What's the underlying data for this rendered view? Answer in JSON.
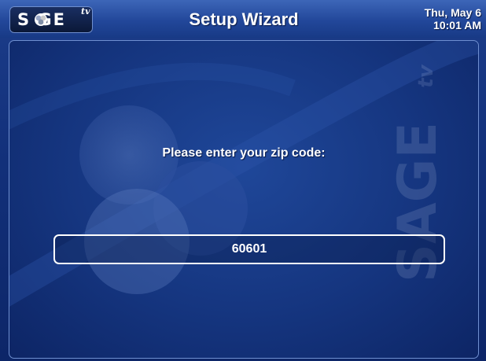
{
  "header": {
    "logo_text": "S GE",
    "logo_superscript": "tv",
    "title": "Setup Wizard",
    "date": "Thu, May 6",
    "time": "10:01 AM"
  },
  "main": {
    "prompt": "Please enter your zip code:",
    "zip_value": "60601",
    "watermark_text": "SAGE",
    "watermark_superscript": "tv"
  },
  "colors": {
    "background": "#12307a",
    "header": "#22479a",
    "text": "#ffffff"
  }
}
